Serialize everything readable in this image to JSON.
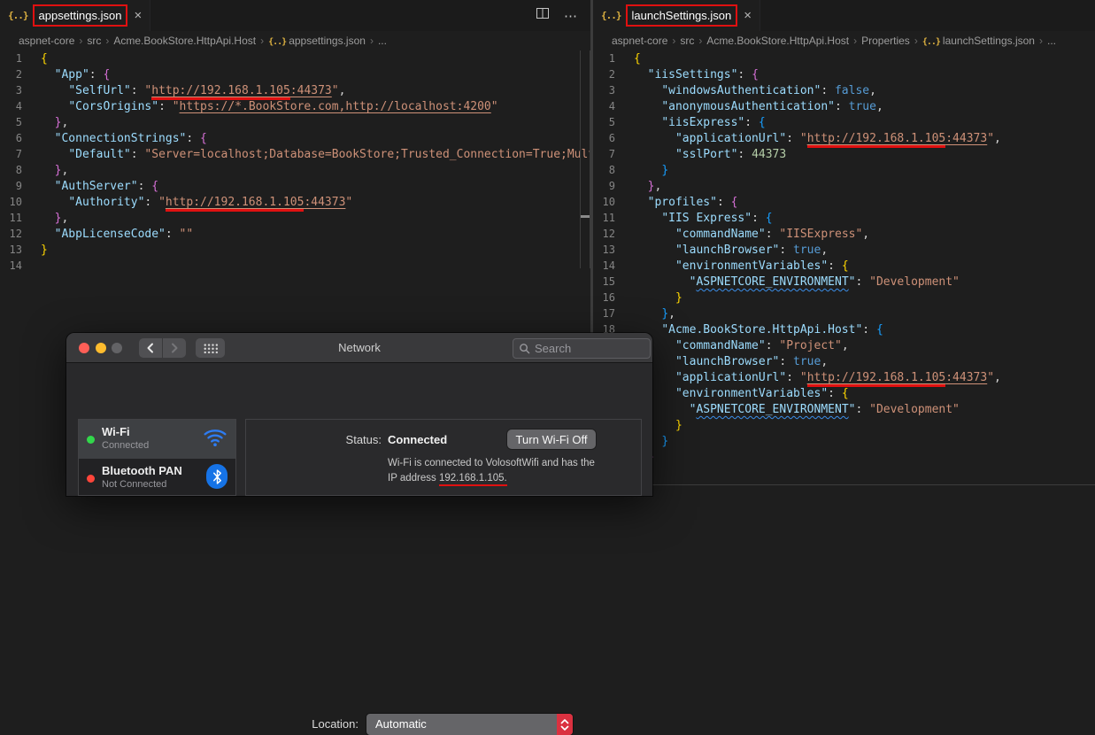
{
  "colors": {
    "annotation_red": "#e01010",
    "editor_background": "#1e1e1e",
    "dropdown_accent_red": "#da3140",
    "wifi_dot_green": "#32d74b",
    "bluetooth_dot_red": "#ff453a"
  },
  "icons": {
    "json_glyph": "{..}",
    "ellipsis_glyph": "⋯",
    "breadcrumb_sep": "›",
    "names": [
      "json-file-icon",
      "split-editor-icon",
      "more-actions-icon",
      "close-icon",
      "back-icon",
      "forward-icon",
      "show-all-grid-icon",
      "search-icon",
      "wifi-icon",
      "bluetooth-icon",
      "dropdown-stepper-icon"
    ]
  },
  "left_editor": {
    "tab": {
      "label": "appsettings.json",
      "close_label": "×"
    },
    "breadcrumb": [
      "aspnet-core",
      "src",
      "Acme.BookStore.HttpApi.Host",
      "appsettings.json",
      "..."
    ],
    "lines": [
      [
        [
          "b0",
          "{"
        ]
      ],
      [
        [
          "w",
          "  "
        ],
        [
          "k",
          "\"App\""
        ],
        [
          "w",
          ": "
        ],
        [
          "b1",
          "{"
        ]
      ],
      [
        [
          "w",
          "    "
        ],
        [
          "k",
          "\"SelfUrl\""
        ],
        [
          "w",
          ": "
        ],
        [
          "s",
          "\""
        ],
        [
          "sr",
          "http://192.168.1.105"
        ],
        [
          "sl",
          ":44373"
        ],
        [
          "s",
          "\""
        ],
        [
          "w",
          ","
        ]
      ],
      [
        [
          "w",
          "    "
        ],
        [
          "k",
          "\"CorsOrigins\""
        ],
        [
          "w",
          ": "
        ],
        [
          "s",
          "\""
        ],
        [
          "sl",
          "https://*.BookStore.com,http://localhost:4200"
        ],
        [
          "s",
          "\""
        ]
      ],
      [
        [
          "w",
          "  "
        ],
        [
          "b1",
          "}"
        ],
        [
          "w",
          ","
        ]
      ],
      [
        [
          "w",
          "  "
        ],
        [
          "k",
          "\"ConnectionStrings\""
        ],
        [
          "w",
          ": "
        ],
        [
          "b1",
          "{"
        ]
      ],
      [
        [
          "w",
          "    "
        ],
        [
          "k",
          "\"Default\""
        ],
        [
          "w",
          ": "
        ],
        [
          "s",
          "\"Server=localhost;Database=BookStore;Trusted_Connection=True;Multipl"
        ]
      ],
      [
        [
          "w",
          "  "
        ],
        [
          "b1",
          "}"
        ],
        [
          "w",
          ","
        ]
      ],
      [
        [
          "w",
          "  "
        ],
        [
          "k",
          "\"AuthServer\""
        ],
        [
          "w",
          ": "
        ],
        [
          "b1",
          "{"
        ]
      ],
      [
        [
          "w",
          "    "
        ],
        [
          "k",
          "\"Authority\""
        ],
        [
          "w",
          ": "
        ],
        [
          "s",
          "\""
        ],
        [
          "sr",
          "http://192.168.1.105"
        ],
        [
          "sl",
          ":44373"
        ],
        [
          "s",
          "\""
        ]
      ],
      [
        [
          "w",
          "  "
        ],
        [
          "b1",
          "}"
        ],
        [
          "w",
          ","
        ]
      ],
      [
        [
          "w",
          "  "
        ],
        [
          "k",
          "\"AbpLicenseCode\""
        ],
        [
          "w",
          ": "
        ],
        [
          "s",
          "\"\""
        ]
      ],
      [
        [
          "b0",
          "}"
        ]
      ],
      []
    ]
  },
  "right_editor": {
    "tab": {
      "label": "launchSettings.json",
      "close_label": "×"
    },
    "breadcrumb": [
      "aspnet-core",
      "src",
      "Acme.BookStore.HttpApi.Host",
      "Properties",
      "launchSettings.json",
      "..."
    ],
    "lines": [
      [
        [
          "b0",
          "{"
        ]
      ],
      [
        [
          "w",
          "  "
        ],
        [
          "k",
          "\"iisSettings\""
        ],
        [
          "w",
          ": "
        ],
        [
          "b1",
          "{"
        ]
      ],
      [
        [
          "w",
          "    "
        ],
        [
          "k",
          "\"windowsAuthentication\""
        ],
        [
          "w",
          ": "
        ],
        [
          "t",
          "false"
        ],
        [
          "w",
          ","
        ]
      ],
      [
        [
          "w",
          "    "
        ],
        [
          "k",
          "\"anonymousAuthentication\""
        ],
        [
          "w",
          ": "
        ],
        [
          "t",
          "true"
        ],
        [
          "w",
          ","
        ]
      ],
      [
        [
          "w",
          "    "
        ],
        [
          "k",
          "\"iisExpress\""
        ],
        [
          "w",
          ": "
        ],
        [
          "b2",
          "{"
        ]
      ],
      [
        [
          "w",
          "      "
        ],
        [
          "k",
          "\"applicationUrl\""
        ],
        [
          "w",
          ": "
        ],
        [
          "s",
          "\""
        ],
        [
          "sr",
          "http://192.168.1.105"
        ],
        [
          "sl",
          ":44373"
        ],
        [
          "s",
          "\""
        ],
        [
          "w",
          ","
        ]
      ],
      [
        [
          "w",
          "      "
        ],
        [
          "k",
          "\"sslPort\""
        ],
        [
          "w",
          ": "
        ],
        [
          "n",
          "44373"
        ]
      ],
      [
        [
          "w",
          "    "
        ],
        [
          "b2",
          "}"
        ]
      ],
      [
        [
          "w",
          "  "
        ],
        [
          "b1",
          "}"
        ],
        [
          "w",
          ","
        ]
      ],
      [
        [
          "w",
          "  "
        ],
        [
          "k",
          "\"profiles\""
        ],
        [
          "w",
          ": "
        ],
        [
          "b1",
          "{"
        ]
      ],
      [
        [
          "w",
          "    "
        ],
        [
          "k",
          "\"IIS Express\""
        ],
        [
          "w",
          ": "
        ],
        [
          "b2",
          "{"
        ]
      ],
      [
        [
          "w",
          "      "
        ],
        [
          "k",
          "\"commandName\""
        ],
        [
          "w",
          ": "
        ],
        [
          "s",
          "\"IISExpress\""
        ],
        [
          "w",
          ","
        ]
      ],
      [
        [
          "w",
          "      "
        ],
        [
          "k",
          "\"launchBrowser\""
        ],
        [
          "w",
          ": "
        ],
        [
          "t",
          "true"
        ],
        [
          "w",
          ","
        ]
      ],
      [
        [
          "w",
          "      "
        ],
        [
          "k",
          "\"environmentVariables\""
        ],
        [
          "w",
          ": "
        ],
        [
          "b0",
          "{"
        ]
      ],
      [
        [
          "w",
          "        "
        ],
        [
          "k",
          "\""
        ],
        [
          "q",
          "ASPNETCORE_ENVIRONMENT"
        ],
        [
          "k",
          "\""
        ],
        [
          "w",
          ": "
        ],
        [
          "s",
          "\"Development\""
        ]
      ],
      [
        [
          "w",
          "      "
        ],
        [
          "b0",
          "}"
        ]
      ],
      [
        [
          "w",
          "    "
        ],
        [
          "b2",
          "}"
        ],
        [
          "w",
          ","
        ]
      ],
      [
        [
          "w",
          "    "
        ],
        [
          "k",
          "\"Acme.BookStore.HttpApi.Host\""
        ],
        [
          "w",
          ": "
        ],
        [
          "b2",
          "{"
        ]
      ],
      [
        [
          "w",
          "      "
        ],
        [
          "k",
          "\"commandName\""
        ],
        [
          "w",
          ": "
        ],
        [
          "s",
          "\"Project\""
        ],
        [
          "w",
          ","
        ]
      ],
      [
        [
          "w",
          "      "
        ],
        [
          "k",
          "\"launchBrowser\""
        ],
        [
          "w",
          ": "
        ],
        [
          "t",
          "true"
        ],
        [
          "w",
          ","
        ]
      ],
      [
        [
          "w",
          "      "
        ],
        [
          "k",
          "\"applicationUrl\""
        ],
        [
          "w",
          ": "
        ],
        [
          "s",
          "\""
        ],
        [
          "sr",
          "http://192.168.1.105"
        ],
        [
          "sl",
          ":44373"
        ],
        [
          "s",
          "\""
        ],
        [
          "w",
          ","
        ]
      ],
      [
        [
          "w",
          "      "
        ],
        [
          "k",
          "\"environmentVariables\""
        ],
        [
          "w",
          ": "
        ],
        [
          "b0",
          "{"
        ]
      ],
      [
        [
          "w",
          "        "
        ],
        [
          "k",
          "\""
        ],
        [
          "q",
          "ASPNETCORE_ENVIRONMENT"
        ],
        [
          "k",
          "\""
        ],
        [
          "w",
          ": "
        ],
        [
          "s",
          "\"Development\""
        ]
      ],
      [
        [
          "w",
          "      "
        ],
        [
          "b0",
          "}"
        ]
      ],
      [
        [
          "w",
          "    "
        ],
        [
          "b2",
          "}"
        ]
      ],
      [
        [
          "w",
          "  "
        ],
        [
          "b1",
          "}"
        ]
      ]
    ]
  },
  "network": {
    "title": "Network",
    "search_placeholder": "Search",
    "location_label": "Location:",
    "location_value": "Automatic",
    "services": [
      {
        "name": "Wi-Fi",
        "status": "Connected",
        "selected": true
      },
      {
        "name": "Bluetooth PAN",
        "status": "Not Connected",
        "selected": false
      }
    ],
    "status_label": "Status:",
    "status_value": "Connected",
    "wifi_off_button": "Turn Wi-Fi Off",
    "description_line1": "Wi-Fi is connected to VolosoftWifi and has the",
    "description_line2_prefix": "IP address ",
    "description_ip": "192.168.1.105."
  }
}
